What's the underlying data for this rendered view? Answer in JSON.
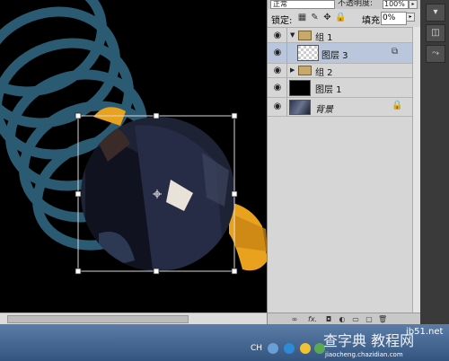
{
  "panel": {
    "blend_mode": "正常",
    "opacity_label": "不透明度:",
    "opacity_value": "100%",
    "lock_label": "锁定:",
    "fill_label": "填充:",
    "fill_value": "0%",
    "layers": [
      {
        "name": "组 1",
        "kind": "group",
        "expanded": true
      },
      {
        "name": "图层 3",
        "kind": "layer",
        "selected": true
      },
      {
        "name": "组 2",
        "kind": "group",
        "expanded": false
      },
      {
        "name": "图层 1",
        "kind": "layer"
      },
      {
        "name": "背景",
        "kind": "background",
        "locked": true
      }
    ],
    "bottom_fx": "fx."
  },
  "taskbar": {
    "lang": "CH"
  },
  "watermark": {
    "text": "查字典 教程网",
    "site": "jb51.net",
    "url": "jiaocheng.chazidian.com"
  },
  "colors": {
    "spring": "#2b5b73",
    "gold": "#e9a21e",
    "selection": "#b9c6dc"
  }
}
